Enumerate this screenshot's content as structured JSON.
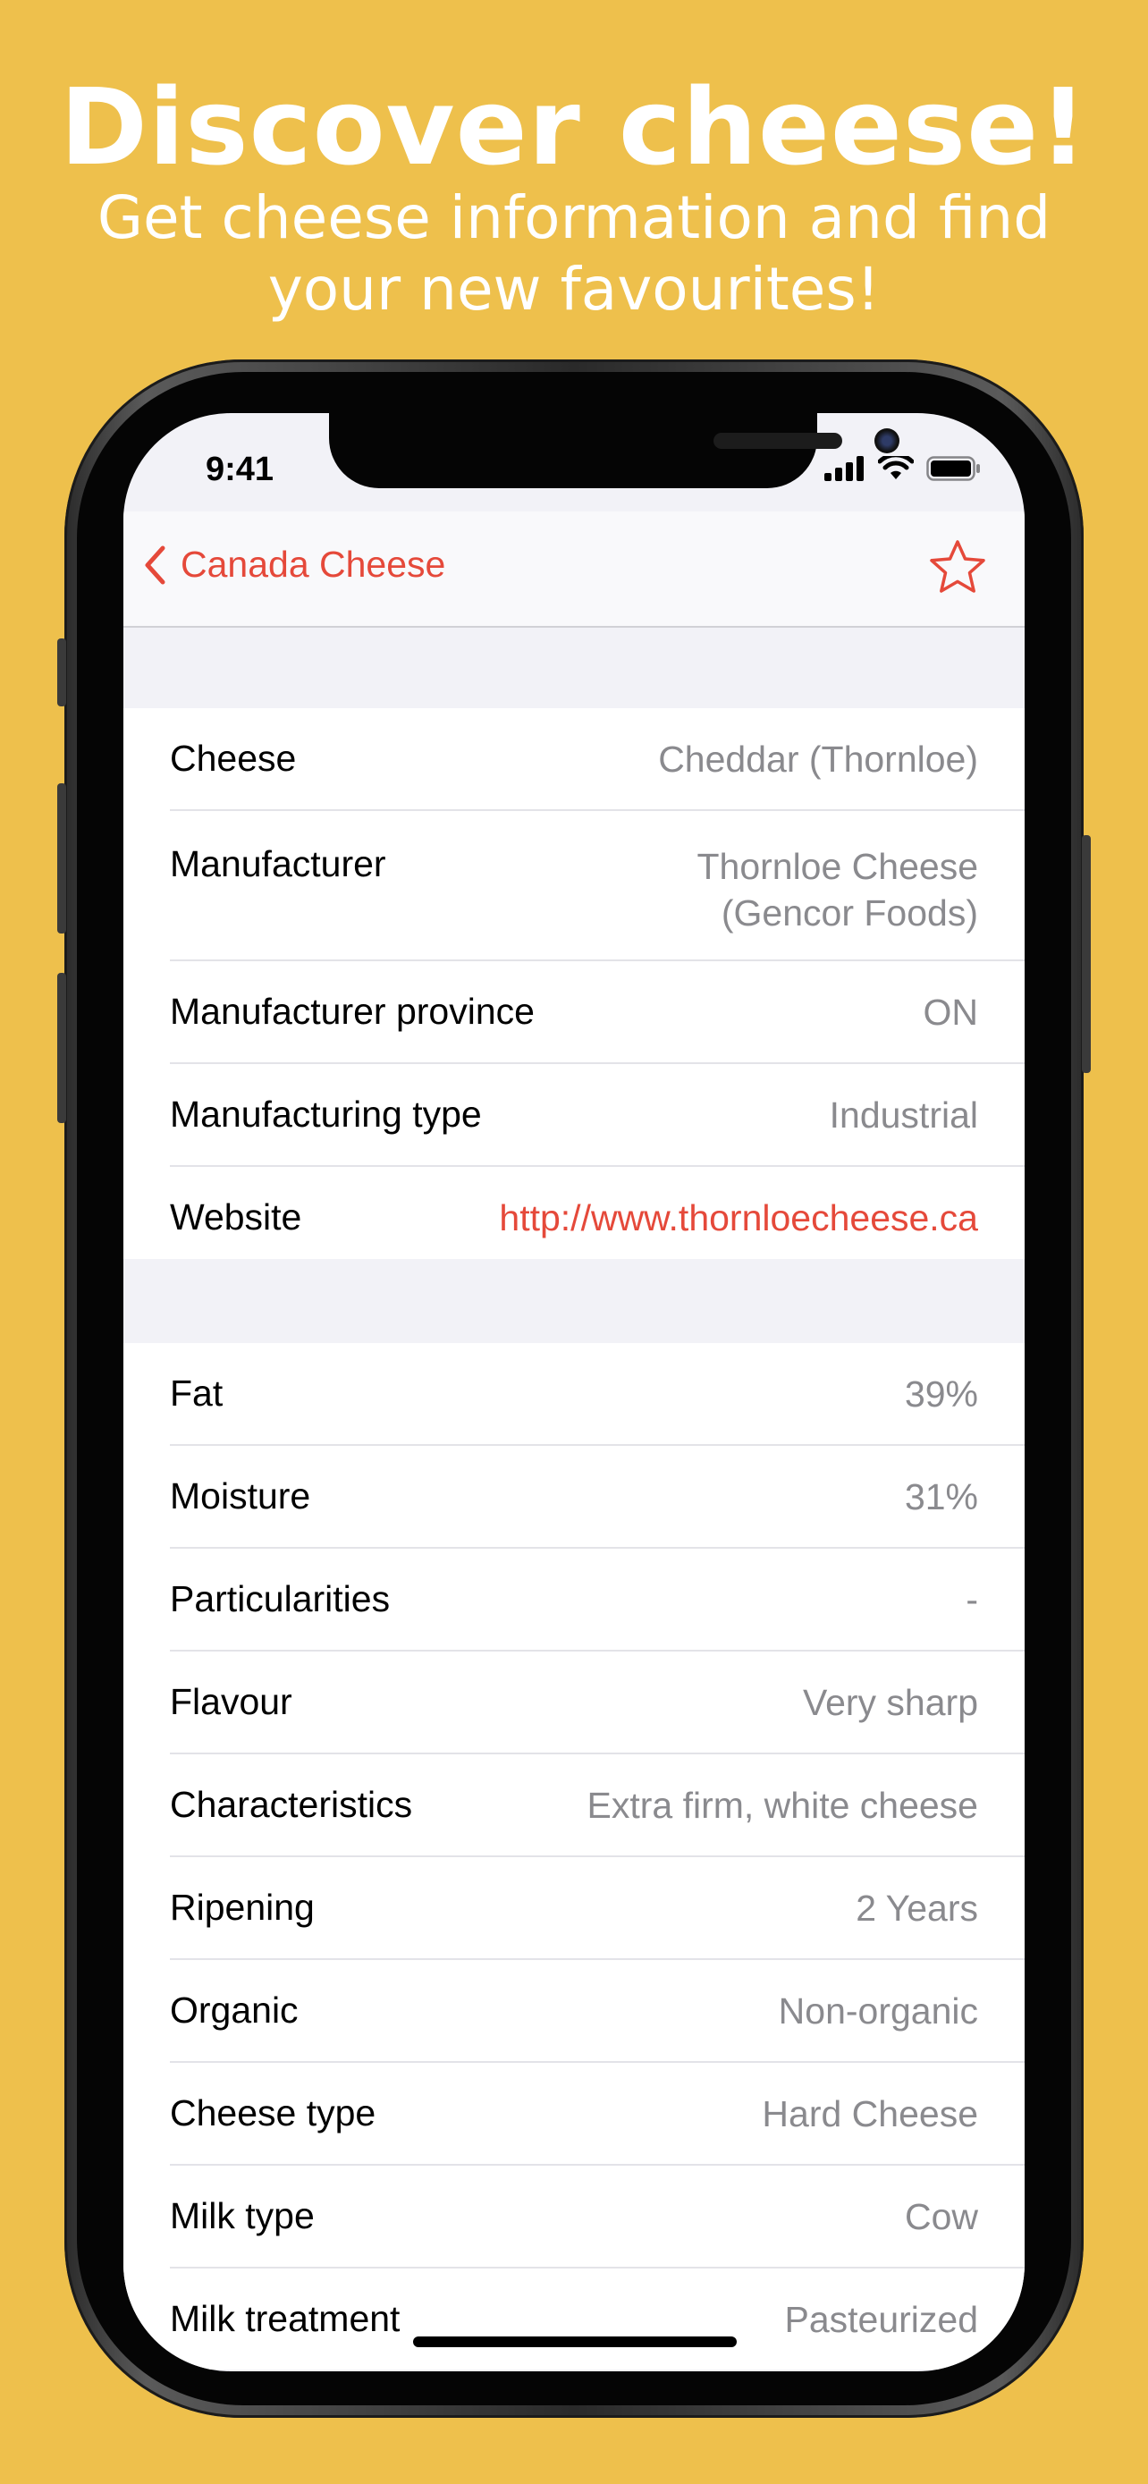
{
  "promo": {
    "title": "Discover cheese!",
    "subtitle_line1": "Get cheese information and find",
    "subtitle_line2": "your new favourites!"
  },
  "status_bar": {
    "time": "9:41"
  },
  "nav": {
    "back_label": "Canada Cheese",
    "favorite_icon": "star-outline-icon"
  },
  "general": [
    {
      "label": "Cheese",
      "value": "Cheddar (Thornloe)"
    },
    {
      "label": "Manufacturer",
      "value_line1": "Thornloe Cheese",
      "value_line2": "(Gencor Foods)"
    },
    {
      "label": "Manufacturer province",
      "value": "ON"
    },
    {
      "label": "Manufacturing type",
      "value": "Industrial"
    },
    {
      "label": "Website",
      "value": "http://www.thornloecheese.ca"
    }
  ],
  "details": [
    {
      "label": "Fat",
      "value": "39%"
    },
    {
      "label": "Moisture",
      "value": "31%"
    },
    {
      "label": "Particularities",
      "value": "-"
    },
    {
      "label": "Flavour",
      "value": "Very sharp"
    },
    {
      "label": "Characteristics",
      "value": "Extra firm, white cheese"
    },
    {
      "label": "Ripening",
      "value": "2 Years"
    },
    {
      "label": "Organic",
      "value": "Non-organic"
    },
    {
      "label": "Cheese type",
      "value": "Hard Cheese"
    },
    {
      "label": "Milk type",
      "value": "Cow"
    },
    {
      "label": "Milk treatment",
      "value": "Pasteurized"
    }
  ],
  "colors": {
    "background": "#EEC04C",
    "accent": "#E5493A"
  }
}
